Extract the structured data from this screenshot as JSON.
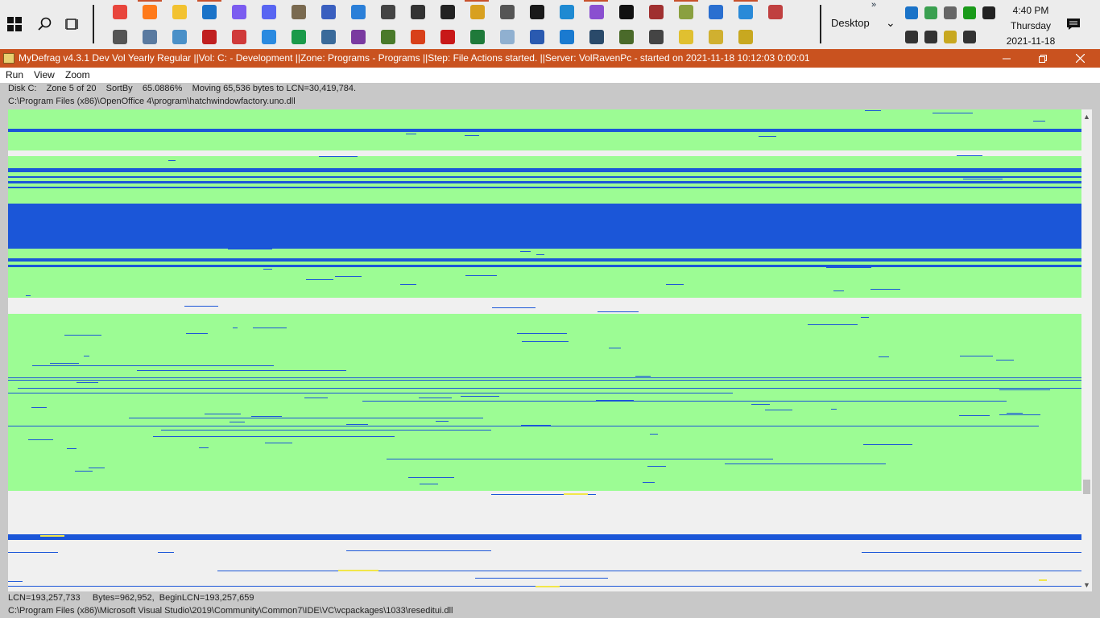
{
  "taskbar": {
    "desktop_label": "Desktop",
    "clock": {
      "time": "4:40 PM",
      "day": "Thursday",
      "date": "2021-11-18"
    },
    "pinned_row1": [
      {
        "name": "chrome-icon",
        "color": "#e8453c"
      },
      {
        "name": "firefox-icon",
        "color": "#ff7a1a"
      },
      {
        "name": "file-explorer-icon",
        "color": "#f2c230"
      },
      {
        "name": "outlook-icon",
        "color": "#1a73c8"
      },
      {
        "name": "messenger-icon",
        "color": "#7b5cf0"
      },
      {
        "name": "discord-icon",
        "color": "#5865f2"
      },
      {
        "name": "gimp-icon",
        "color": "#7a6a50"
      },
      {
        "name": "visio-icon",
        "color": "#3a5fbf"
      },
      {
        "name": "photos-icon",
        "color": "#2a7fd8"
      },
      {
        "name": "scanner-icon",
        "color": "#444444"
      },
      {
        "name": "printer-icon",
        "color": "#333333"
      },
      {
        "name": "robot-icon",
        "color": "#222222"
      },
      {
        "name": "calendar-app-icon",
        "color": "#d8a020"
      },
      {
        "name": "clock-check-icon",
        "color": "#555555"
      },
      {
        "name": "terminal-icon",
        "color": "#1a1a1a"
      },
      {
        "name": "vscode-icon",
        "color": "#1f8ad2"
      },
      {
        "name": "visual-studio-icon",
        "color": "#8a4fd0"
      },
      {
        "name": "command-prompt-icon",
        "color": "#111111"
      },
      {
        "name": "tool-icon",
        "color": "#a03030"
      },
      {
        "name": "settings-app-icon",
        "color": "#8aa040"
      },
      {
        "name": "powershell-icon",
        "color": "#2a6fd0"
      },
      {
        "name": "azure-icon",
        "color": "#2a8ad8"
      },
      {
        "name": "pdf-tool-icon",
        "color": "#c04040"
      }
    ],
    "pinned_row2": [
      {
        "name": "gear-icon",
        "color": "#555555"
      },
      {
        "name": "device-manager-icon",
        "color": "#5a7aa0"
      },
      {
        "name": "network-icon",
        "color": "#4a90c8"
      },
      {
        "name": "acrobat-icon",
        "color": "#c02020"
      },
      {
        "name": "pdf-editor-icon",
        "color": "#d03a3a"
      },
      {
        "name": "todo-icon",
        "color": "#2a8ae0"
      },
      {
        "name": "money-icon",
        "color": "#1a9a4a"
      },
      {
        "name": "photo-viewer-icon",
        "color": "#3a6a9a"
      },
      {
        "name": "onenote-icon",
        "color": "#7a3aa0"
      },
      {
        "name": "palm-tree-icon",
        "color": "#4a7a2a"
      },
      {
        "name": "office-icon",
        "color": "#d8401a"
      },
      {
        "name": "adobe-reader-icon",
        "color": "#c81818"
      },
      {
        "name": "excel-icon",
        "color": "#1f7a3a"
      },
      {
        "name": "notepad-icon",
        "color": "#90b0d0"
      },
      {
        "name": "word-icon",
        "color": "#2a5ab0"
      },
      {
        "name": "edge-icon",
        "color": "#1a7ad0"
      },
      {
        "name": "file-manager-icon",
        "color": "#2a4a6a"
      },
      {
        "name": "spreadsheet-tool-icon",
        "color": "#4a6a2a"
      },
      {
        "name": "camera-icon",
        "color": "#444444"
      },
      {
        "name": "help-icon",
        "color": "#e0c030"
      },
      {
        "name": "help-doc-icon",
        "color": "#d0b030"
      },
      {
        "name": "mydefrag-icon",
        "color": "#c8a820"
      }
    ],
    "tray": [
      {
        "name": "outlook-tray-icon",
        "color": "#1a73c8"
      },
      {
        "name": "shield-tray-icon",
        "color": "#3aa050"
      },
      {
        "name": "onedrive-icon",
        "color": "#666666"
      },
      {
        "name": "battery-meter-icon",
        "color": "#1a9a1a"
      },
      {
        "name": "microphone-icon",
        "color": "#222222"
      },
      {
        "name": "network-tray-icon",
        "color": "#333333"
      },
      {
        "name": "volume-icon",
        "color": "#333333"
      },
      {
        "name": "clipboard-tray-icon",
        "color": "#c8a820"
      },
      {
        "name": "robot-tray-icon",
        "color": "#333333"
      }
    ]
  },
  "window": {
    "title": "MyDefrag v4.3.1   Dev Vol Yearly Regular ||Vol: C: - Development ||Zone: Programs - Programs ||Step: File Actions started. ||Server: VolRavenPc -  started on 2021-11-18 10:12:03 0:00:01",
    "accent": "#c9521f"
  },
  "menu": [
    "Run",
    "View",
    "Zoom"
  ],
  "status": {
    "line1": "Disk C:    Zone 5 of 20    SortBy    65.0886%    Moving 65,536 bytes to LCN=30,419,784.",
    "line2": "C:\\Program Files (x86)\\OpenOffice 4\\program\\hatchwindowfactory.uno.dll"
  },
  "footer": {
    "line1": "LCN=193,257,733     Bytes=962,952,  BeginLCN=193,257,659",
    "line2": "C:\\Program Files (x86)\\Microsoft Visual Studio\\2019\\Community\\Common7\\IDE\\VC\\vcpackages\\1033\\reseditui.dll"
  },
  "colors": {
    "free_space": "#f0f0f0",
    "unfragmented": "#9cfc94",
    "fragmented_file": "#1b56d8",
    "busy": "#f2e64a"
  }
}
